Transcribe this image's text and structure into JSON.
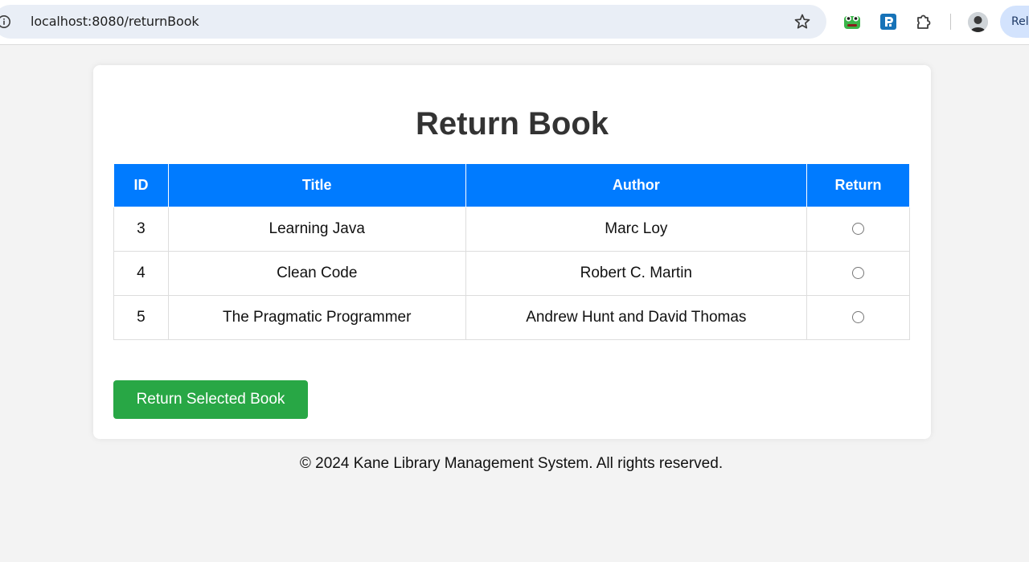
{
  "browser": {
    "url": "localhost:8080/returnBook",
    "relaunch_label": "Rela"
  },
  "page": {
    "title": "Return Book",
    "table": {
      "headers": [
        "ID",
        "Title",
        "Author",
        "Return"
      ],
      "rows": [
        {
          "id": "3",
          "title": "Learning Java",
          "author": "Marc Loy"
        },
        {
          "id": "4",
          "title": "Clean Code",
          "author": "Robert C. Martin"
        },
        {
          "id": "5",
          "title": "The Pragmatic Programmer",
          "author": "Andrew Hunt and David Thomas"
        }
      ]
    },
    "submit_label": "Return Selected Book",
    "footer": "© 2024 Kane Library Management System. All rights reserved."
  },
  "colors": {
    "header_bg": "#007bff",
    "button_bg": "#28a745",
    "page_bg": "#f3f3f3"
  },
  "icons": [
    "info-icon",
    "star-icon",
    "frog-extension-icon",
    "p-extension-icon",
    "puzzle-icon",
    "avatar"
  ]
}
